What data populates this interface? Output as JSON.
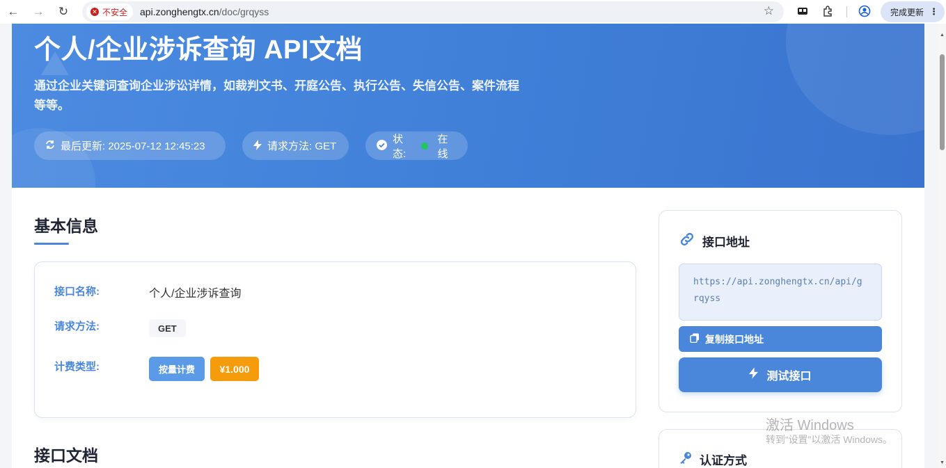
{
  "browser": {
    "security_label": "不安全",
    "url_domain": "api.zonghengtx.cn",
    "url_path": "/doc/grqyss",
    "update_button": "完成更新"
  },
  "hero": {
    "title": "个人/企业涉诉查询 API文档",
    "description": "通过企业关键词查询企业涉讼详情，如裁判文书、开庭公告、执行公告、失信公告、案件流程等等。",
    "last_updated": "最后更新: 2025-07-12 12:45:23",
    "request_method": "请求方法: GET",
    "status_label": "状态:",
    "status_value": "在线"
  },
  "basic_info": {
    "title": "基本信息",
    "name_label": "接口名称:",
    "name_value": "个人/企业涉诉查询",
    "method_label": "请求方法:",
    "method_value": "GET",
    "billing_label": "计费类型:",
    "billing_type": "按量计费",
    "price": "¥1.000"
  },
  "docs": {
    "title": "接口文档"
  },
  "endpoint_card": {
    "title": "接口地址",
    "url": "https://api.zonghengtx.cn/api/grqyss",
    "copy_button": "复制接口地址",
    "test_button": "测试接口"
  },
  "auth_card": {
    "title": "认证方式"
  },
  "watermark": {
    "line1": "激活 Windows",
    "line2": "转到“设置”以激活 Windows。"
  },
  "colors": {
    "accent": "#4a87db",
    "price_tag": "#f49c0b",
    "status_online": "#22c55e"
  }
}
